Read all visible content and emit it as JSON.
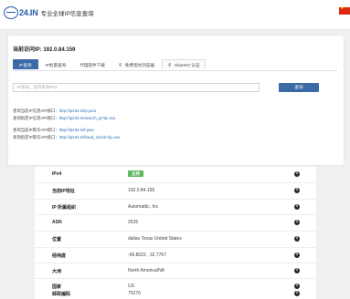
{
  "header": {
    "logo_text": "24.IN",
    "site_name": "专业全球IP信息查询"
  },
  "query": {
    "current_ip_label": "当前访问IP: 192.0.84.159",
    "tabs": [
      {
        "label": "IP查询",
        "icon": ""
      },
      {
        "label": "IP批量查询",
        "icon": ""
      },
      {
        "label": "代理软件下载",
        "icon": ""
      },
      {
        "label": "免费指纹浏览器",
        "icon": "share-icon"
      },
      {
        "label": "ShareIO 认证",
        "icon": "share-icon"
      }
    ],
    "search_placeholder": "IP查询，支持查询IPv6",
    "search_button": "查询",
    "api_lines": [
      {
        "prefix": "查询当前IP信息API接口：",
        "url": "http://ip234.in/ip.json"
      },
      {
        "prefix": "查询指定IP信息API接口：",
        "url": "http://ip234.in/search_ip?ip=xxx"
      },
      {
        "prefix": "查询当前IP欺诈API接口：",
        "url": "http://ip234.in/f.json"
      },
      {
        "prefix": "查询指定IP欺诈API接口：",
        "url": "http://ip234.in/fraud_check?ip=xxx"
      }
    ]
  },
  "result": {
    "rows": [
      {
        "label": "IPv4",
        "value": "支持",
        "badge": true,
        "badge_color": "#5cb85c"
      },
      {
        "label": "当前IP地址",
        "value": "192.0.84.159"
      },
      {
        "label": "IP 所属组织",
        "value": "Automattic, Inc"
      },
      {
        "label": "ASN",
        "value": "2635"
      },
      {
        "label": "位置",
        "value": "dallas Texas United States"
      },
      {
        "label": "经纬度",
        "value": "-96.8022 , 32.7767"
      },
      {
        "label": "大洲",
        "value": "North America/NA"
      },
      {
        "label": "国家",
        "value": "US"
      },
      {
        "label": "邮政编码",
        "value": "75270"
      }
    ],
    "info_icon": "info-icon"
  },
  "colors": {
    "primary": "#3c6aa6",
    "link": "#2a6ab8",
    "success": "#5cb85c"
  }
}
